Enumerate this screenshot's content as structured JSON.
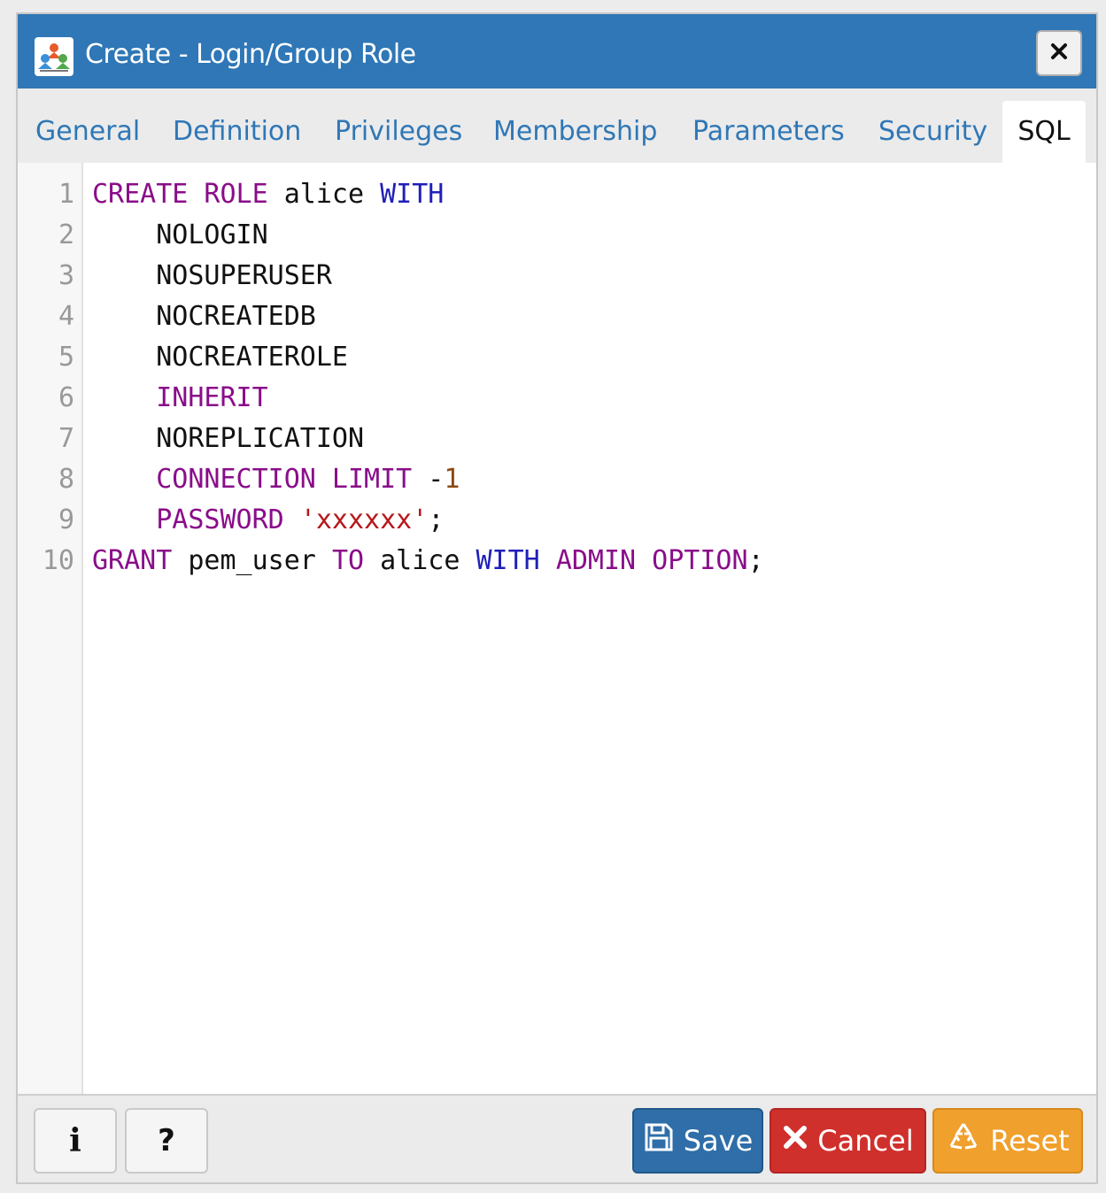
{
  "dialog": {
    "title": "Create - Login/Group Role",
    "close_label": "×"
  },
  "tabs": [
    {
      "label": "General"
    },
    {
      "label": "Definition"
    },
    {
      "label": "Privileges"
    },
    {
      "label": "Membership"
    },
    {
      "label": "Parameters"
    },
    {
      "label": "Security"
    },
    {
      "label": "SQL",
      "active": true
    }
  ],
  "editor": {
    "line_numbers": [
      "1",
      "2",
      "3",
      "4",
      "5",
      "6",
      "7",
      "8",
      "9",
      "10"
    ],
    "lines": [
      [
        {
          "t": "kw",
          "v": "CREATE ROLE"
        },
        {
          "t": "",
          "v": " alice "
        },
        {
          "t": "kw2",
          "v": "WITH"
        }
      ],
      [
        {
          "t": "",
          "v": "    NOLOGIN"
        }
      ],
      [
        {
          "t": "",
          "v": "    NOSUPERUSER"
        }
      ],
      [
        {
          "t": "",
          "v": "    NOCREATEDB"
        }
      ],
      [
        {
          "t": "",
          "v": "    NOCREATEROLE"
        }
      ],
      [
        {
          "t": "",
          "v": "    "
        },
        {
          "t": "kw",
          "v": "INHERIT"
        }
      ],
      [
        {
          "t": "",
          "v": "    NOREPLICATION"
        }
      ],
      [
        {
          "t": "",
          "v": "    "
        },
        {
          "t": "kw",
          "v": "CONNECTION LIMIT"
        },
        {
          "t": "",
          "v": " -"
        },
        {
          "t": "num",
          "v": "1"
        }
      ],
      [
        {
          "t": "",
          "v": "    "
        },
        {
          "t": "kw",
          "v": "PASSWORD"
        },
        {
          "t": "",
          "v": " "
        },
        {
          "t": "str",
          "v": "'xxxxxx'"
        },
        {
          "t": "",
          "v": ";"
        }
      ],
      [
        {
          "t": "kw",
          "v": "GRANT"
        },
        {
          "t": "",
          "v": " pem_user "
        },
        {
          "t": "kw",
          "v": "TO"
        },
        {
          "t": "",
          "v": " alice "
        },
        {
          "t": "kw2",
          "v": "WITH"
        },
        {
          "t": "",
          "v": " "
        },
        {
          "t": "kw",
          "v": "ADMIN OPTION"
        },
        {
          "t": "",
          "v": ";"
        }
      ]
    ]
  },
  "footer": {
    "info_label": "i",
    "help_label": "?",
    "save_label": "Save",
    "cancel_label": "Cancel",
    "reset_label": "Reset"
  },
  "colors": {
    "title_bar": "#2f77b6",
    "keyword": "#8a0d8a",
    "keyword_alt": "#2020b8",
    "string": "#b8161a",
    "number": "#8a4a14",
    "save": "#2f6ea8",
    "cancel": "#d0302c",
    "reset": "#f0a02c"
  }
}
